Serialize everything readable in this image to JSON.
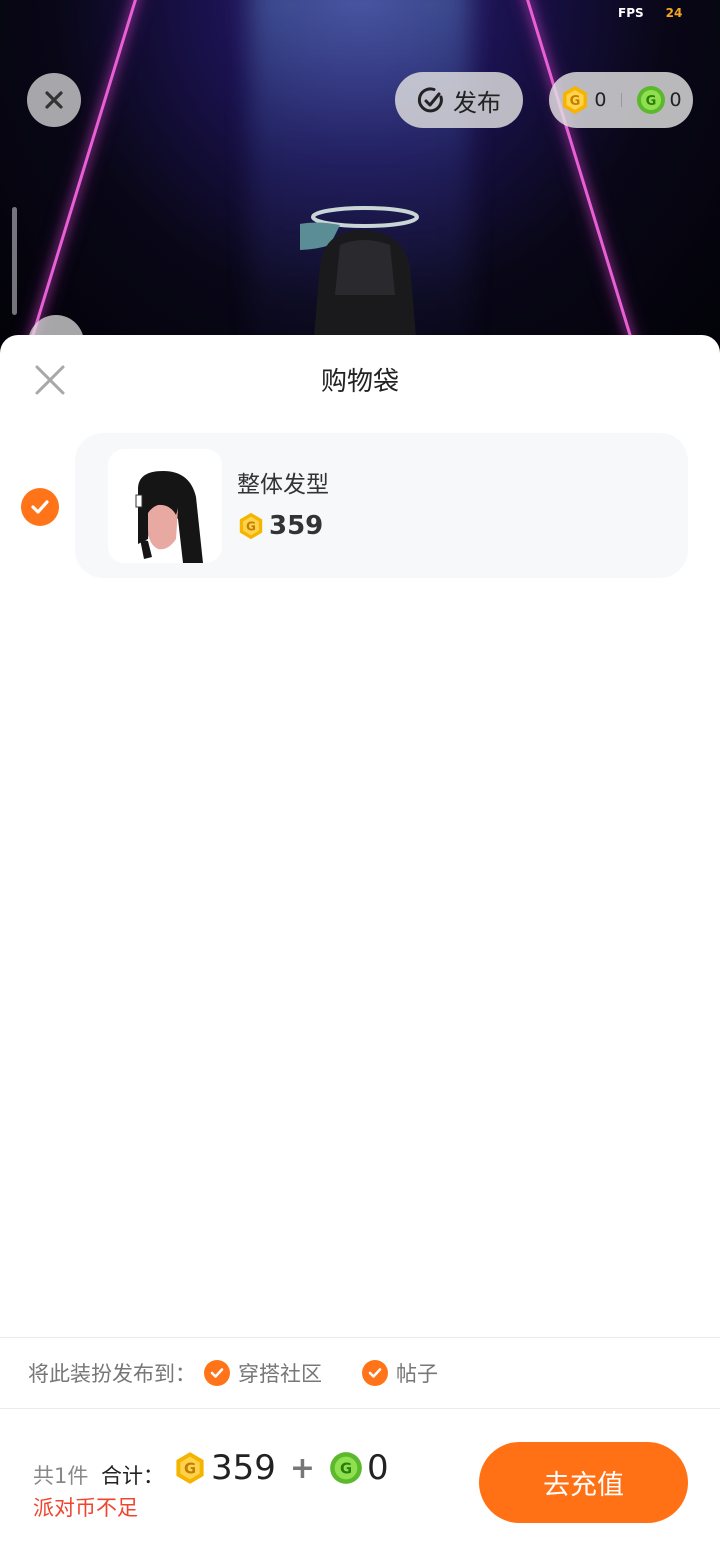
{
  "hud": {
    "fps_label": "FPS",
    "fps_value": "24",
    "publish_label": "发布",
    "gold_coins": "0",
    "green_coins": "0"
  },
  "sheet": {
    "title": "购物袋",
    "items": [
      {
        "name": "整体发型",
        "price": "359",
        "selected": true
      }
    ]
  },
  "publish_to": {
    "label": "将此装扮发布到：",
    "options": [
      {
        "label": "穿搭社区",
        "checked": true
      },
      {
        "label": "帖子",
        "checked": true
      }
    ]
  },
  "footer": {
    "count_text": "共1件",
    "total_label": "合计：",
    "gold_total": "359",
    "plus": "+",
    "green_total": "0",
    "warning": "派对币不足",
    "recharge_button": "去充值"
  },
  "colors": {
    "accent": "#ff7114",
    "warning": "#f0442e",
    "gold_coin": "#f4b400",
    "green_coin": "#6fcf3a"
  }
}
